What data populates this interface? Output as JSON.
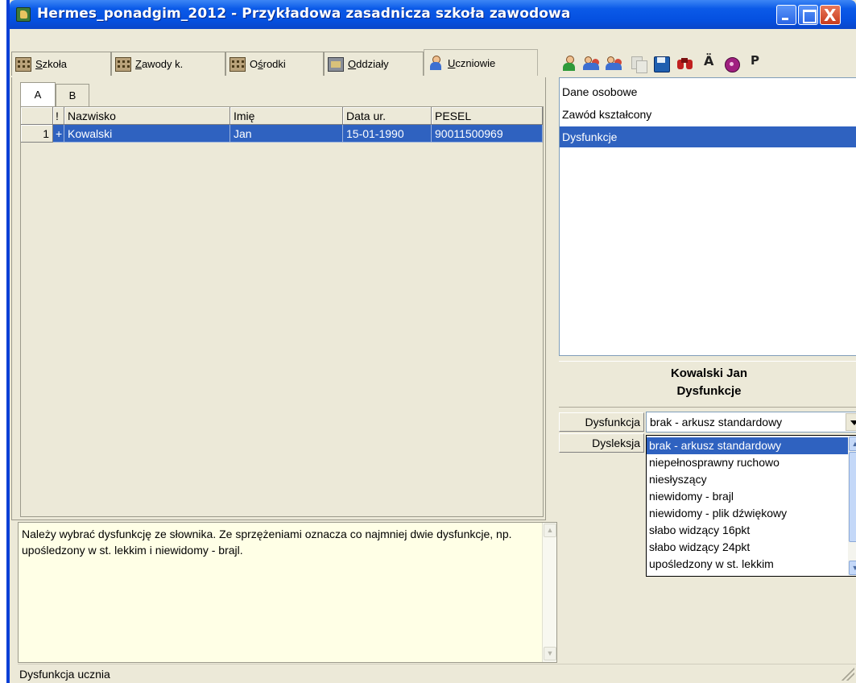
{
  "window": {
    "title": "Hermes_ponadgim_2012 - Przykładowa zasadnicza szkoła zawodowa",
    "close_glyph": "X"
  },
  "tabs": [
    {
      "label": "Szkoła",
      "underline": "S",
      "rest": "zkoła",
      "icon": "building-icon"
    },
    {
      "label": "Zawody k.",
      "underline": "Z",
      "rest": "awody k.",
      "icon": "building-icon"
    },
    {
      "label": "Ośrodki",
      "pre": "O",
      "underline": "ś",
      "rest": "rodki",
      "icon": "building-icon"
    },
    {
      "label": "Oddziały",
      "underline": "O",
      "rest": "ddziały",
      "icon": "classroom-icon"
    },
    {
      "label": "Uczniowie",
      "underline": "U",
      "rest": "czniowie",
      "icon": "student-icon",
      "active": true
    }
  ],
  "subtabs": [
    "A",
    "B"
  ],
  "grid": {
    "columns": [
      "",
      "!",
      "Nazwisko",
      "Imię",
      "Data ur.",
      "PESEL"
    ],
    "rows": [
      {
        "num": "1",
        "mark": "+",
        "nazwisko": "Kowalski",
        "imie": "Jan",
        "data_ur": "15-01-1990",
        "pesel": "90011500969",
        "selected": true
      }
    ]
  },
  "hint": {
    "text": "Należy wybrać dysfunkcję ze słownika. Ze sprzężeniami oznacza co najmniej dwie dysfunkcje, np. upośledzony w st. lekkim i niewidomy - brajl."
  },
  "toolbar": {
    "icons": [
      "add-student-icon",
      "students-icon",
      "group-icon",
      "copy-icon",
      "save-icon",
      "search-binoculars-icon",
      "umlaut-a-icon",
      "disk-icon",
      "p-icon"
    ],
    "umlaut_label": "Ä",
    "p_label": "P"
  },
  "sections": [
    {
      "label": "Dane osobowe",
      "selected": false
    },
    {
      "label": "Zawód kształcony",
      "selected": false
    },
    {
      "label": "Dysfunkcje",
      "selected": true
    }
  ],
  "detail": {
    "name": "Kowalski Jan",
    "section": "Dysfunkcje",
    "fields": {
      "dysfunkcja_label": "Dysfunkcja",
      "dysfunkcja_value": "brak - arkusz standardowy",
      "dysleksja_label": "Dysleksja"
    },
    "dropdown_options": [
      {
        "label": "brak - arkusz standardowy",
        "selected": true
      },
      {
        "label": "niepełnosprawny ruchowo",
        "selected": false
      },
      {
        "label": "niesłyszący",
        "selected": false
      },
      {
        "label": "niewidomy - brajl",
        "selected": false
      },
      {
        "label": "niewidomy - plik dźwiękowy",
        "selected": false
      },
      {
        "label": "słabo widzący 16pkt",
        "selected": false
      },
      {
        "label": "słabo widzący 24pkt",
        "selected": false
      },
      {
        "label": "upośledzony w st. lekkim",
        "selected": false
      }
    ]
  },
  "status": {
    "text": "Dysfunkcja ucznia"
  },
  "colors": {
    "titlebar": "#0550e0",
    "selection": "#2f62c0",
    "hint_bg": "#ffffe6",
    "window_bg": "#ece9d8"
  }
}
